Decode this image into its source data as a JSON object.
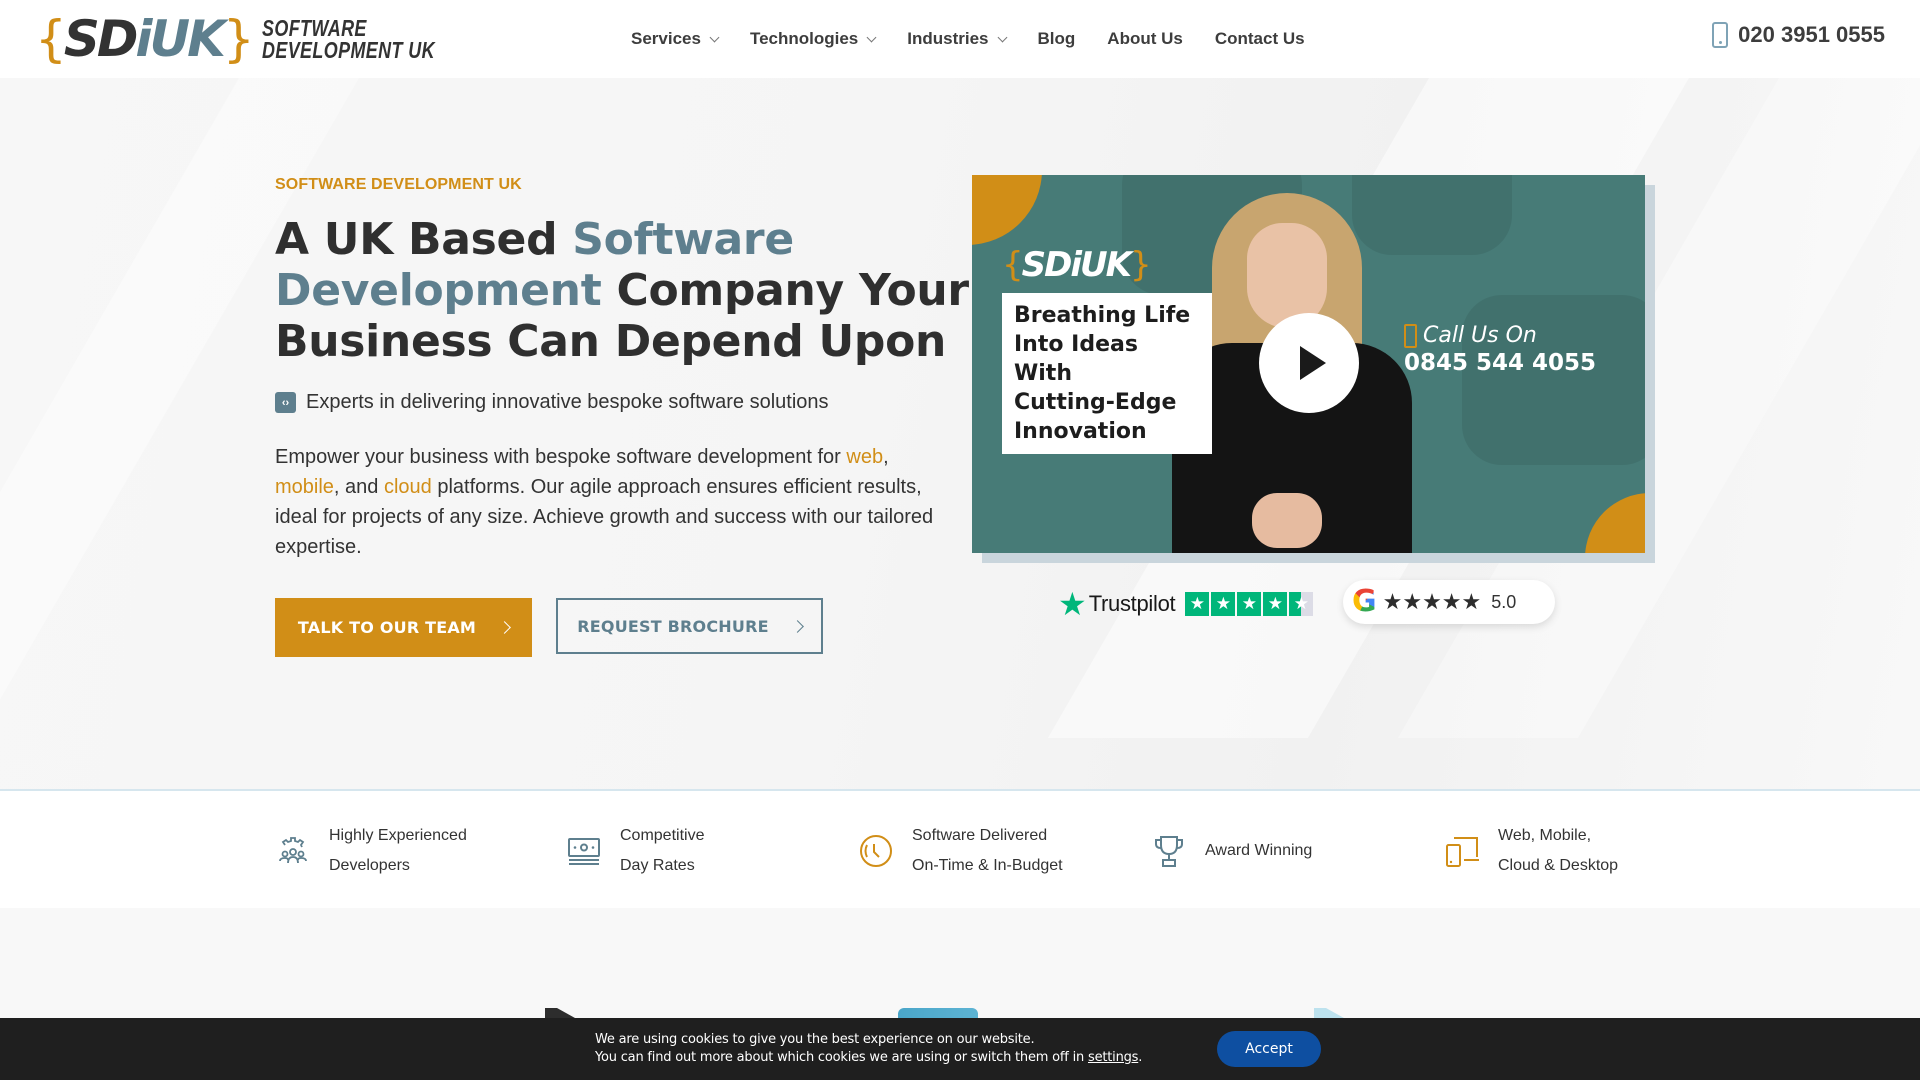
{
  "header": {
    "logo": {
      "bracket_open": "{",
      "sd": "SD",
      "uk": "iUK",
      "bracket_close": "}",
      "line1": "SOFTWARE",
      "line2": "DEVELOPMENT UK"
    },
    "nav": [
      {
        "label": "Services",
        "has_dropdown": true
      },
      {
        "label": "Technologies",
        "has_dropdown": true
      },
      {
        "label": "Industries",
        "has_dropdown": true
      },
      {
        "label": "Blog",
        "has_dropdown": false
      },
      {
        "label": "About Us",
        "has_dropdown": false
      },
      {
        "label": "Contact Us",
        "has_dropdown": false
      }
    ],
    "phone": {
      "icon": "mobile-phone-icon",
      "number": "020 3951 0555"
    }
  },
  "hero": {
    "eyebrow": "SOFTWARE DEVELOPMENT UK",
    "title": {
      "part1": "A UK Based ",
      "accent": "Software Development",
      "part2": " Company Your Business Can Depend Upon"
    },
    "tagline": {
      "icon": "code-brackets-icon",
      "text": "Experts in delivering innovative bespoke software solutions"
    },
    "paragraph": {
      "before_web": "Empower your business with bespoke software development for ",
      "link_web": "web",
      "after_web": ", ",
      "link_mobile": "mobile",
      "after_mobile": ", and ",
      "link_cloud": "cloud",
      "rest": " platforms. Our agile approach ensures efficient results, ideal for projects of any size. Achieve growth and success with our tailored expertise."
    },
    "buttons": {
      "primary": "TALK TO OUR TEAM",
      "secondary": "REQUEST BROCHURE"
    },
    "video": {
      "logo": {
        "open": "{",
        "text": "SDiUK",
        "close": "}"
      },
      "caption": [
        "Breathing Life",
        "Into Ideas With",
        "Cutting-Edge",
        "Innovation"
      ],
      "call_label": "Call Us On",
      "call_number": "0845 544 4055",
      "play_icon": "play-icon"
    },
    "ratings": {
      "trustpilot": {
        "name": "Trustpilot",
        "stars": 4.5,
        "max": 5
      },
      "google": {
        "stars": 5,
        "score": "5.0"
      }
    }
  },
  "features": [
    {
      "icon": "developers-gear-icon",
      "line1": "Highly Experienced",
      "line2": "Developers"
    },
    {
      "icon": "money-bill-icon",
      "line1": "Competitive",
      "line2": "Day Rates"
    },
    {
      "icon": "clock-icon",
      "line1": "Software Delivered",
      "line2": "On-Time & In-Budget"
    },
    {
      "icon": "trophy-icon",
      "line1": "Award Winning",
      "line2": ""
    },
    {
      "icon": "devices-icon",
      "line1": "Web, Mobile,",
      "line2": "Cloud & Desktop"
    }
  ],
  "colors": {
    "gold": "#d18e17",
    "slate": "#5e7f8e",
    "teal_video": "#477b77",
    "trustpilot_green": "#00b67a",
    "accept_blue": "#0e4fa1",
    "cookie_bg": "#1f1f1f"
  },
  "cookie": {
    "line1": "We are using cookies to give you the best experience on our website.",
    "line2_before": "You can find out more about which cookies we are using or switch them off in ",
    "settings_link": "settings",
    "line2_after": ".",
    "accept": "Accept"
  }
}
